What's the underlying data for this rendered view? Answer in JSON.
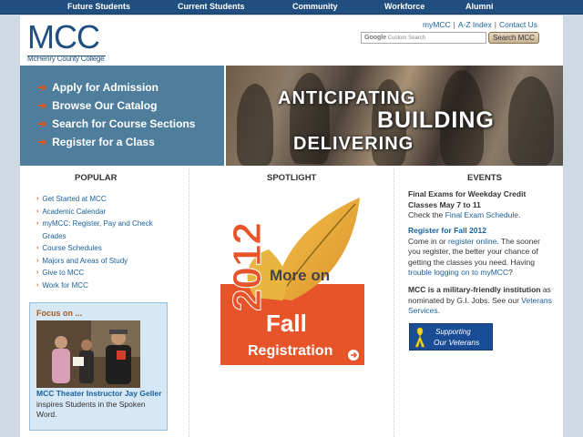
{
  "topnav": {
    "items": [
      "Future Students",
      "Current Students",
      "Community",
      "Workforce",
      "Alumni"
    ]
  },
  "logo": {
    "title": "MCC",
    "subtitle": "McHenry County College"
  },
  "utility": {
    "links": [
      "myMCC",
      "A-Z Index",
      "Contact Us"
    ]
  },
  "search": {
    "google": "Google",
    "placeholder": "Custom Search",
    "button": "Search MCC"
  },
  "quicklinks": [
    "Apply for Admission",
    "Browse Our Catalog",
    "Search for Course Sections",
    "Register for a Class"
  ],
  "banner": {
    "line1": "ANTICIPATING",
    "line2": "BUILDING",
    "line3": "DELIVERING"
  },
  "popular": {
    "heading": "POPULAR",
    "items": [
      "Get Started at MCC",
      "Academic Calendar",
      "myMCC: Register, Pay and Check",
      "Grades",
      "Course Schedules",
      "Majors and Areas of Study",
      "Give to MCC",
      "Work for MCC"
    ]
  },
  "focus": {
    "title": "Focus on ...",
    "link": "MCC Theater Instructor Jay Geller",
    "text": " inspires Students in the Spoken Word."
  },
  "spotlight": {
    "heading": "SPOTLIGHT",
    "year": "2012",
    "more_on": "More on",
    "fall": "Fall",
    "registration": "Registration"
  },
  "events": {
    "heading": "EVENTS",
    "e1_title": "Final Exams for Weekday Credit Classes May 7 to 11",
    "e1_pre": "Check the ",
    "e1_link": "Final Exam Schedule",
    "e1_post": ".",
    "e2_title": "Register for Fall 2012",
    "e2_pre": "Come in or ",
    "e2_link": "register online",
    "e2_mid": ". The sooner you register, the better your chance of getting the classes you need. Having ",
    "e2_link2": "trouble logging on to myMCC",
    "e2_post": "?",
    "e3_title": "MCC is a military-friendly institution",
    "e3_pre": " as nominated by G.I. Jobs. See our ",
    "e3_link": "Veterans Services",
    "e3_post": ".",
    "badge_line1": "Supporting",
    "badge_line2": "Our Veterans"
  },
  "colors": {
    "nav": "#1f4e7f",
    "quick_bg": "#4f7e9d",
    "accent": "#e0571d",
    "link": "#1a5f9a"
  }
}
